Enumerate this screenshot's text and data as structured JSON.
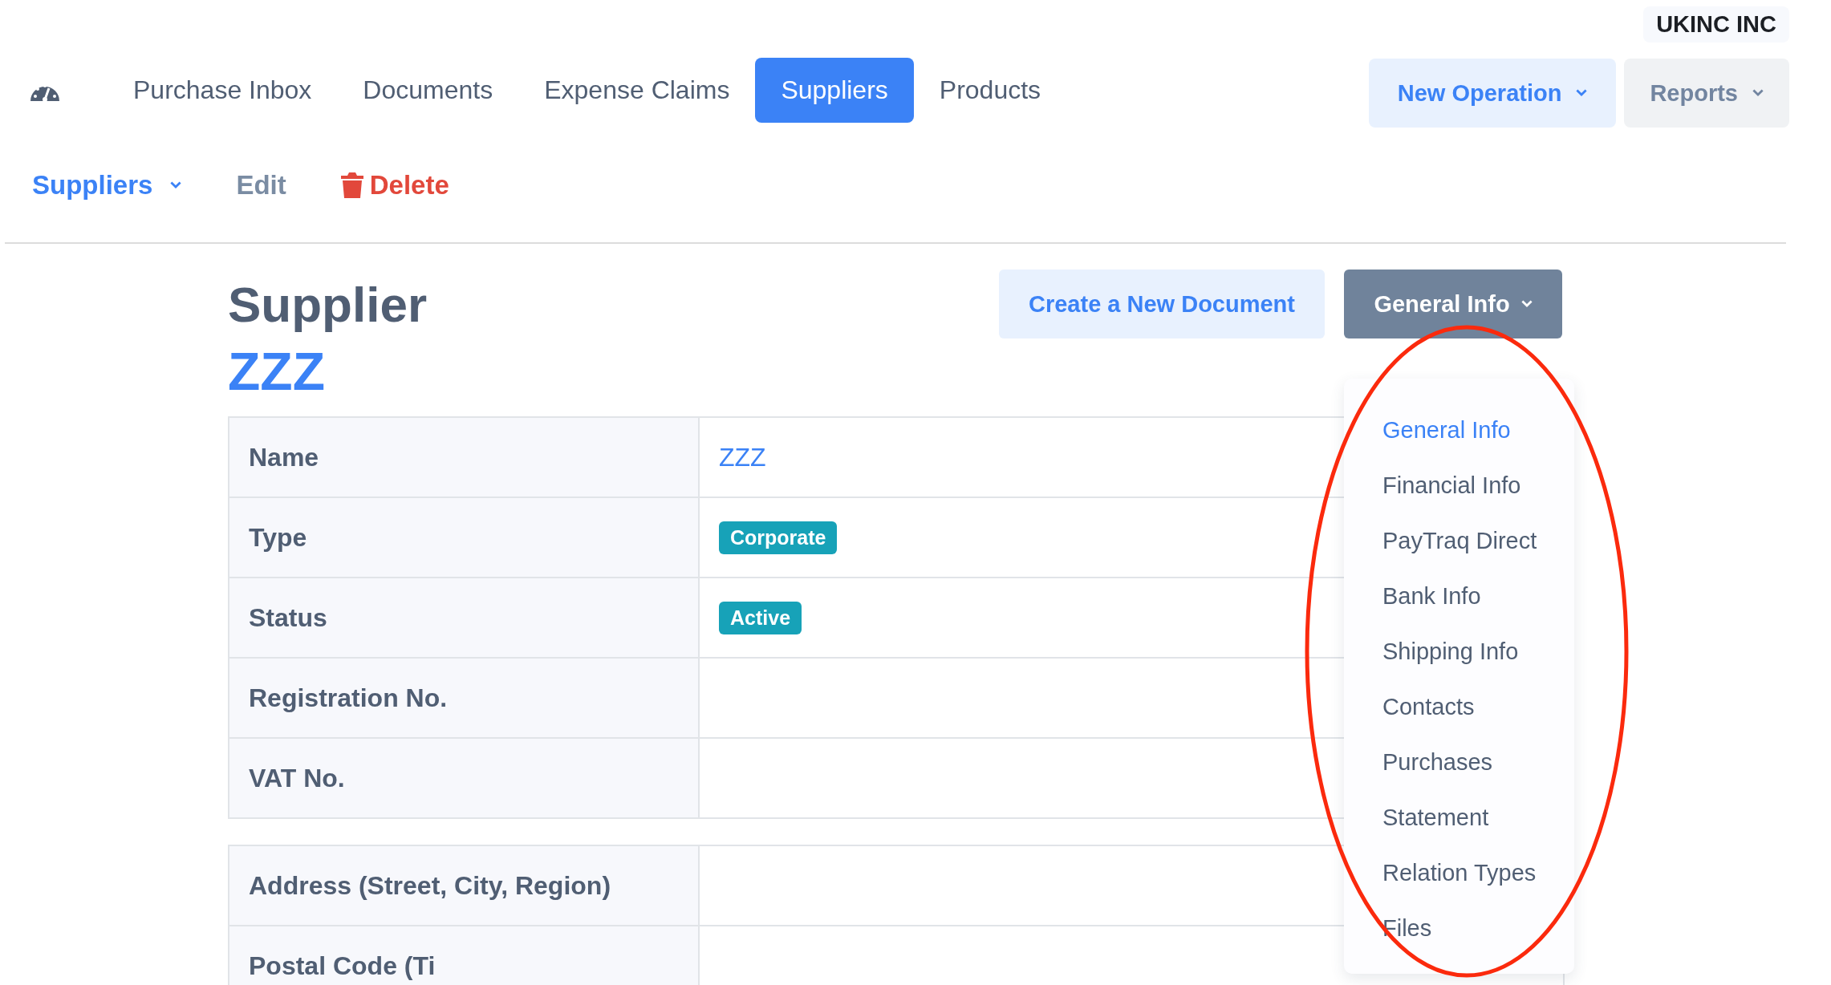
{
  "company": "UKINC INC",
  "nav": [
    {
      "label": "Purchase Inbox",
      "selected": false
    },
    {
      "label": "Documents",
      "selected": false
    },
    {
      "label": "Expense Claims",
      "selected": false
    },
    {
      "label": "Suppliers",
      "selected": true
    },
    {
      "label": "Products",
      "selected": false
    }
  ],
  "actions": [
    {
      "label": "New Operation",
      "kind": "primary"
    },
    {
      "label": "Reports",
      "kind": "secondary"
    }
  ],
  "subnav": [
    {
      "label": "Suppliers",
      "kind": "menu"
    },
    {
      "label": "Edit",
      "kind": "plain"
    },
    {
      "label": "Delete",
      "kind": "danger"
    }
  ],
  "page": {
    "title": "Supplier",
    "name": "ZZZ",
    "create_button": "Create a New Document",
    "section_button": "General Info"
  },
  "section_menu": [
    {
      "label": "General Info",
      "selected": true
    },
    {
      "label": "Financial Info",
      "selected": false
    },
    {
      "label": "PayTraq Direct",
      "selected": false
    },
    {
      "label": "Bank Info",
      "selected": false
    },
    {
      "label": "Shipping Info",
      "selected": false
    },
    {
      "label": "Contacts",
      "selected": false
    },
    {
      "label": "Purchases",
      "selected": false
    },
    {
      "label": "Statement",
      "selected": false
    },
    {
      "label": "Relation Types",
      "selected": false
    },
    {
      "label": "Files",
      "selected": false
    }
  ],
  "tables": [
    [
      {
        "label": "Name",
        "kind": "link",
        "value": "ZZZ"
      },
      {
        "label": "Type",
        "kind": "tag",
        "value": "Corporate"
      },
      {
        "label": "Status",
        "kind": "tag",
        "value": "Active"
      },
      {
        "label": "Registration No.",
        "kind": "empty"
      },
      {
        "label": "VAT No.",
        "kind": "empty"
      }
    ],
    [
      {
        "label": "Address (Street, City, Region)",
        "kind": "empty"
      },
      {
        "label": "Postal Code (Ti",
        "kind": "empty"
      }
    ]
  ],
  "annotations": [
    {
      "kind": "ellipse"
    }
  ]
}
